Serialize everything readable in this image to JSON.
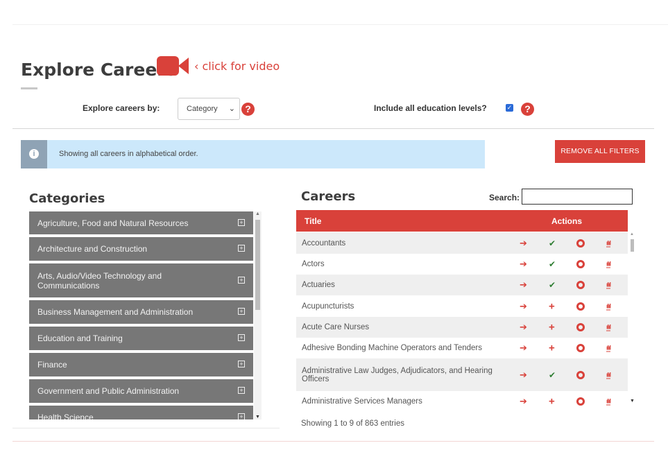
{
  "header": {
    "title": "Explore Careers",
    "video_link": "‹ click for video"
  },
  "filters": {
    "explore_by_label": "Explore careers by:",
    "explore_by_value": "Category",
    "include_education_label": "Include all education levels?",
    "include_education_checked": true,
    "help_symbol": "?"
  },
  "info": {
    "message": "Showing all careers in alphabetical order.",
    "icon": "info-icon"
  },
  "remove_filters_label": "REMOVE ALL FILTERS",
  "categories": {
    "heading": "Categories",
    "items": [
      {
        "label": "Agriculture, Food and Natural Resources"
      },
      {
        "label": "Architecture and Construction"
      },
      {
        "label": "Arts, Audio/Video Technology and Communications"
      },
      {
        "label": "Business Management and Administration"
      },
      {
        "label": "Education and Training"
      },
      {
        "label": "Finance"
      },
      {
        "label": "Government and Public Administration"
      },
      {
        "label": "Health Science"
      }
    ]
  },
  "careers": {
    "heading": "Careers",
    "search_label": "Search:",
    "search_value": "",
    "columns": {
      "title": "Title",
      "actions": "Actions"
    },
    "rows": [
      {
        "title": "Accountants",
        "status": "check"
      },
      {
        "title": "Actors",
        "status": "check"
      },
      {
        "title": "Actuaries",
        "status": "check"
      },
      {
        "title": "Acupuncturists",
        "status": "plus"
      },
      {
        "title": "Acute Care Nurses",
        "status": "plus"
      },
      {
        "title": "Adhesive Bonding Machine Operators and Tenders",
        "status": "plus"
      },
      {
        "title": "Administrative Law Judges, Adjudicators, and Hearing Officers",
        "status": "check"
      },
      {
        "title": "Administrative Services Managers",
        "status": "plus"
      }
    ],
    "footer": "Showing 1 to 9 of 863 entries"
  },
  "colors": {
    "accent": "#d9413a",
    "category_bg": "#777777",
    "info_bg": "#cce8fb",
    "check": "#2e7d32"
  }
}
